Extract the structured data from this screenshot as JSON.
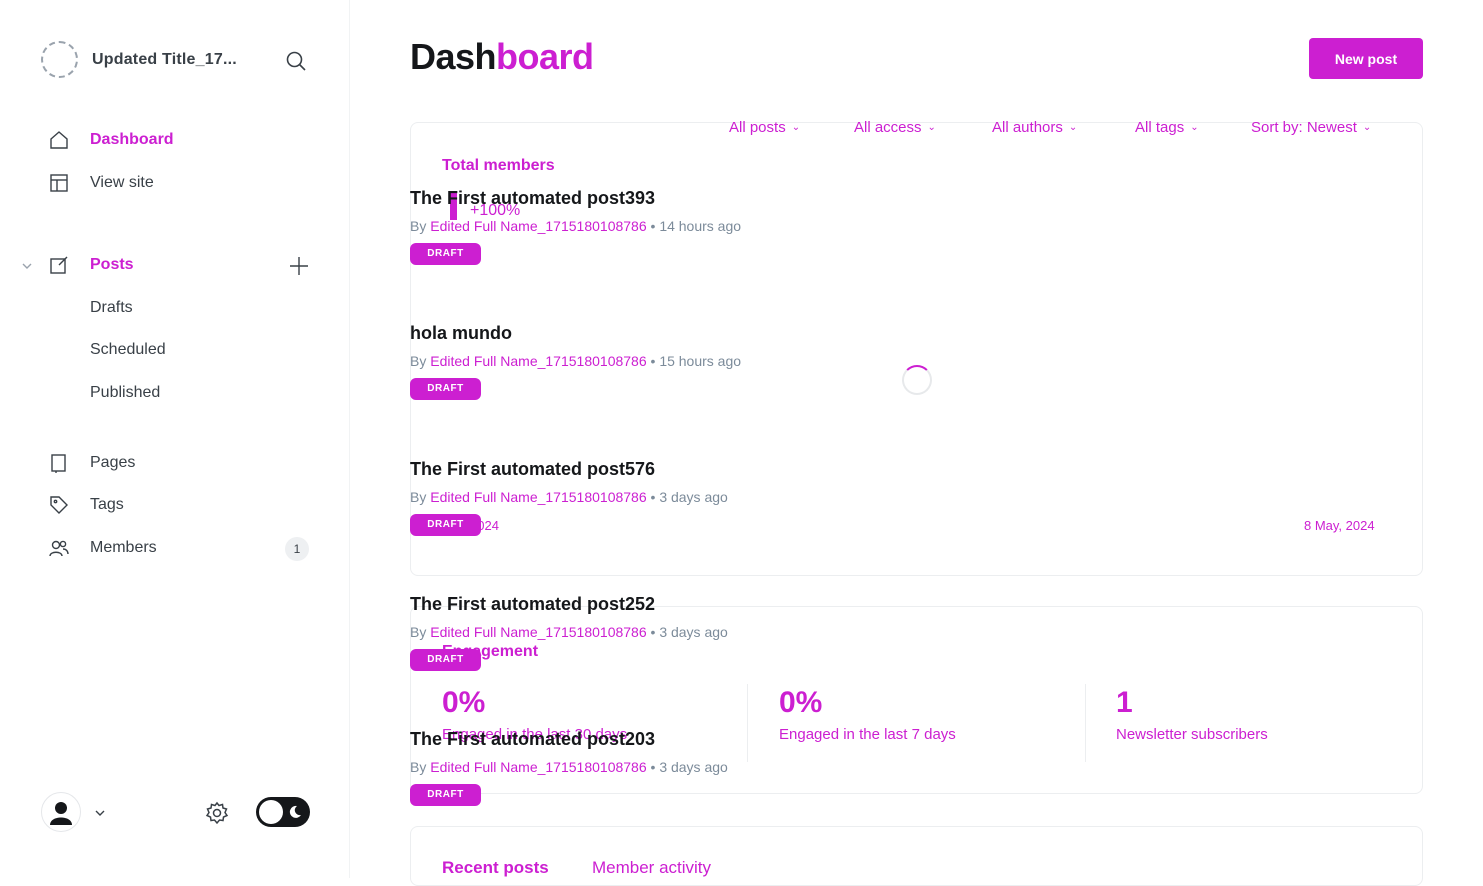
{
  "sidebar": {
    "brand_title": "Updated Title_17...",
    "nav": {
      "dashboard": "Dashboard",
      "view_site": "View site",
      "posts": "Posts",
      "drafts": "Drafts",
      "scheduled": "Scheduled",
      "published": "Published",
      "pages": "Pages",
      "tags": "Tags",
      "members": "Members",
      "members_count": "1"
    }
  },
  "header": {
    "title_part1": "Dash",
    "title_part2": "board",
    "new_post_label": "New post"
  },
  "filters": [
    "All posts",
    "All access",
    "All authors",
    "All tags",
    "Sort by: Newest"
  ],
  "members_card": {
    "label": "Total members",
    "growth": "+100%",
    "date_start": "2024",
    "date_end": "8 May, 2024"
  },
  "engagement": {
    "label": "Engagement",
    "stats": [
      {
        "value": "0%",
        "label": "Engaged in the last 30 days"
      },
      {
        "value": "0%",
        "label": "Engaged in the last 7 days"
      },
      {
        "value": "1",
        "label": "Newsletter subscribers"
      }
    ]
  },
  "recent": {
    "tab_recent": "Recent posts",
    "tab_activity": "Member activity"
  },
  "posts": [
    {
      "title": "The First automated post393",
      "author": "Edited Full Name_1715180108786",
      "time": "14 hours ago",
      "status": "Draft"
    },
    {
      "title": "hola mundo",
      "author": "Edited Full Name_1715180108786",
      "time": "15 hours ago",
      "status": "Draft"
    },
    {
      "title": "The First automated post576",
      "author": "Edited Full Name_1715180108786",
      "time": "3 days ago",
      "status": "Draft"
    },
    {
      "title": "The First automated post252",
      "author": "Edited Full Name_1715180108786",
      "time": "3 days ago",
      "status": "Draft"
    },
    {
      "title": "The First automated post203",
      "author": "Edited Full Name_1715180108786",
      "time": "3 days ago",
      "status": "Draft"
    }
  ],
  "post_meta_prefix": "By",
  "post_meta_sep": "•",
  "colors": {
    "accent": "#cc1fd1",
    "text": "#15171a",
    "muted": "#7c8b9a"
  }
}
